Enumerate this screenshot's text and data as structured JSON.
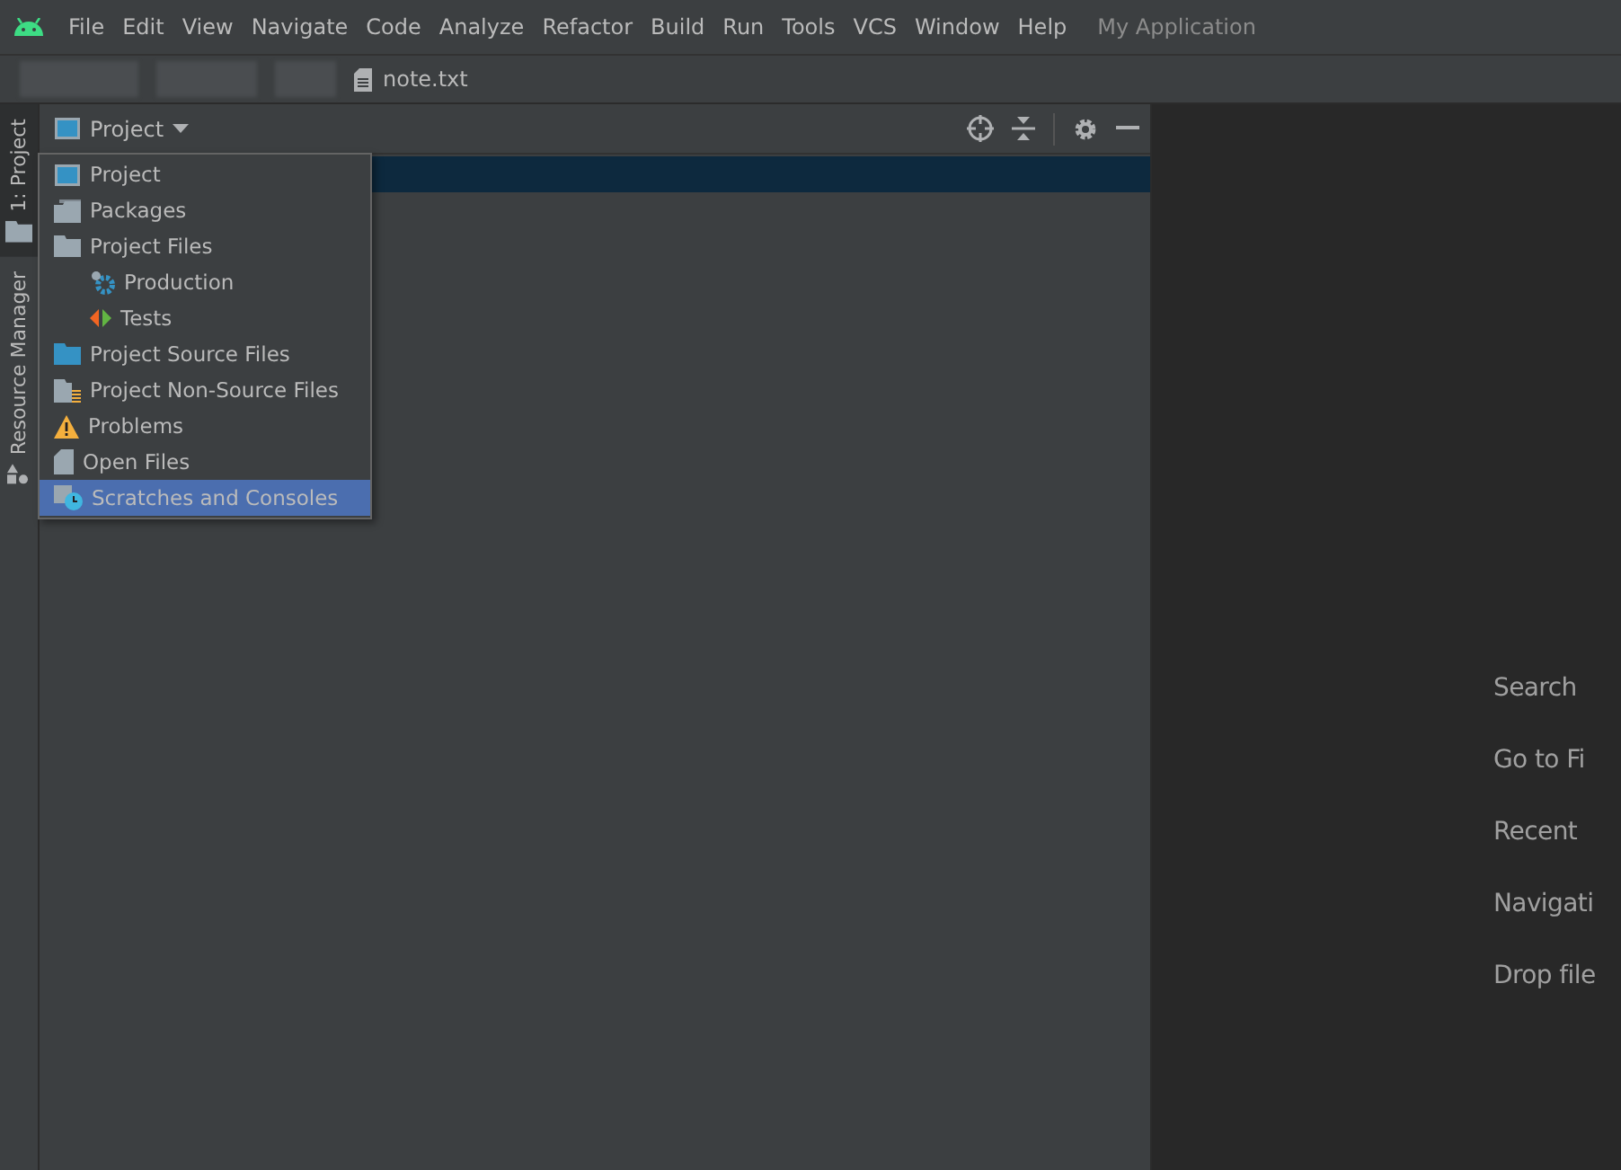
{
  "menu_bar": {
    "items": [
      "File",
      "Edit",
      "View",
      "Navigate",
      "Code",
      "Analyze",
      "Refactor",
      "Build",
      "Run",
      "Tools",
      "VCS",
      "Window",
      "Help"
    ],
    "project_name": "My Application"
  },
  "nav_bar": {
    "file": "note.txt"
  },
  "side_tabs": [
    {
      "label": "1: Project",
      "kind": "folder",
      "selected": true
    },
    {
      "label": "Resource Manager",
      "kind": "resources",
      "selected": false
    }
  ],
  "project_panel": {
    "view_selector": "Project"
  },
  "view_menu": {
    "items": [
      {
        "label": "Project",
        "kind": "project",
        "selected": false
      },
      {
        "label": "Packages",
        "kind": "packages",
        "selected": false
      },
      {
        "label": "Project Files",
        "kind": "folder",
        "selected": false,
        "children": [
          {
            "label": "Production",
            "kind": "production",
            "selected": false
          },
          {
            "label": "Tests",
            "kind": "tests",
            "selected": false
          }
        ]
      },
      {
        "label": "Project Source Files",
        "kind": "source",
        "selected": false
      },
      {
        "label": "Project Non-Source Files",
        "kind": "nonsource",
        "selected": false
      },
      {
        "label": "Problems",
        "kind": "warning",
        "selected": false
      },
      {
        "label": "Open Files",
        "kind": "file",
        "selected": false
      },
      {
        "label": "Scratches and Consoles",
        "kind": "scratch",
        "selected": true
      }
    ]
  },
  "editor_hints": [
    "Search",
    "Go to Fi",
    "Recent",
    "Navigati",
    "Drop file"
  ]
}
